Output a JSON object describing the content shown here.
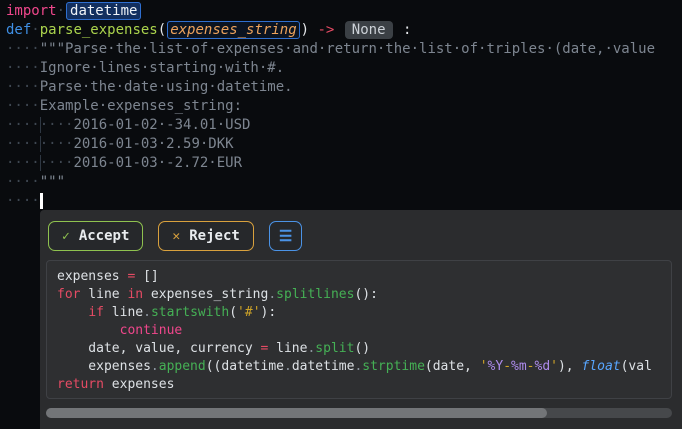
{
  "colors": {
    "editor_bg": "#090b0e",
    "popup_bg": "#2b2c2e",
    "accent_green": "#8fc24f",
    "accent_amber": "#d9a13d",
    "accent_blue": "#4b93e6",
    "highlight_box_blue": "#2f6fd0",
    "keyword_pink": "#f0478c",
    "keyword_red": "#e54b64",
    "function_lime": "#abd44d",
    "string_amber": "#cfa428",
    "method_green": "#45b055",
    "comment_gray": "#7d8590"
  },
  "editor": {
    "lines": [
      [
        [
          "kwp",
          "import"
        ],
        [
          "ws",
          "·"
        ],
        [
          "boxdt",
          "datetime"
        ]
      ],
      [
        [
          "def",
          "def"
        ],
        [
          "ws",
          "·"
        ],
        [
          "fn",
          "parse_expenses"
        ],
        [
          "txt",
          "("
        ],
        [
          "parambox",
          "expenses_string"
        ],
        [
          "txt",
          ")"
        ],
        [
          "sp",
          " "
        ],
        [
          "kwr",
          "->"
        ],
        [
          "sp",
          " "
        ],
        [
          "pill",
          "None"
        ],
        [
          "sp",
          " "
        ],
        [
          "txt",
          ":"
        ]
      ],
      [
        [
          "ws",
          "····"
        ],
        [
          "doc",
          "\"\"\"Parse·the·list·of·expenses·and·return·the·list·of·triples·(date,·value"
        ]
      ],
      [
        [
          "ws",
          "····"
        ],
        [
          "doc",
          "Ignore·lines·starting·with·#."
        ]
      ],
      [
        [
          "ws",
          "····"
        ],
        [
          "doc",
          "Parse·the·date·using·datetime."
        ]
      ],
      [
        [
          "ws",
          "····"
        ],
        [
          "doc",
          "Example·expenses_string:"
        ]
      ],
      [
        [
          "ws",
          "····"
        ],
        [
          "wsg",
          "····"
        ],
        [
          "doc",
          "2016-01-02·-34.01·USD"
        ]
      ],
      [
        [
          "ws",
          "····"
        ],
        [
          "wsg",
          "····"
        ],
        [
          "doc",
          "2016-01-03·2.59·DKK"
        ]
      ],
      [
        [
          "ws",
          "····"
        ],
        [
          "wsg",
          "····"
        ],
        [
          "doc",
          "2016-01-03·-2.72·EUR"
        ]
      ],
      [
        [
          "ws",
          "····"
        ],
        [
          "doc",
          "\"\"\""
        ]
      ],
      [
        [
          "ws",
          "····"
        ],
        [
          "cursor",
          ""
        ]
      ]
    ]
  },
  "popup": {
    "buttons": {
      "accept": {
        "icon": "✓",
        "label": "Accept"
      },
      "reject": {
        "icon": "✕",
        "label": "Reject"
      },
      "menu": {
        "icon": "☰"
      }
    },
    "code_lines": [
      [
        [
          "txt",
          "expenses "
        ],
        [
          "kwr",
          "="
        ],
        [
          "txt",
          " []"
        ]
      ],
      [
        [
          "kwr",
          "for"
        ],
        [
          "txt",
          " line "
        ],
        [
          "kwr",
          "in"
        ],
        [
          "txt",
          " expenses_string"
        ],
        [
          "dot",
          "."
        ],
        [
          "mth",
          "splitlines"
        ],
        [
          "txt",
          "():"
        ]
      ],
      [
        [
          "txt",
          "    "
        ],
        [
          "kwr",
          "if"
        ],
        [
          "txt",
          " line"
        ],
        [
          "dot",
          "."
        ],
        [
          "mth",
          "startswith"
        ],
        [
          "txt",
          "("
        ],
        [
          "str",
          "'#'"
        ],
        [
          "txt",
          "):"
        ]
      ],
      [
        [
          "txt",
          "        "
        ],
        [
          "kwp",
          "continue"
        ]
      ],
      [
        [
          "txt",
          "    date, value, currency "
        ],
        [
          "kwr",
          "="
        ],
        [
          "txt",
          " line"
        ],
        [
          "dot",
          "."
        ],
        [
          "mth",
          "split"
        ],
        [
          "txt",
          "()"
        ]
      ],
      [
        [
          "txt",
          "    expenses"
        ],
        [
          "dot",
          "."
        ],
        [
          "mth",
          "append"
        ],
        [
          "txt",
          "(("
        ],
        [
          "txt",
          "datetime"
        ],
        [
          "dot",
          "."
        ],
        [
          "txt",
          "datetime"
        ],
        [
          "dot",
          "."
        ],
        [
          "mth",
          "strptime"
        ],
        [
          "txt",
          "(date, "
        ],
        [
          "str",
          "'"
        ],
        [
          "fmt",
          "%Y"
        ],
        [
          "str",
          "-"
        ],
        [
          "fmt",
          "%m"
        ],
        [
          "str",
          "-"
        ],
        [
          "fmt",
          "%d"
        ],
        [
          "str",
          "'"
        ],
        [
          "txt",
          "), "
        ],
        [
          "flt",
          "float"
        ],
        [
          "txt",
          "(val"
        ]
      ],
      [
        [
          "kwr",
          "return"
        ],
        [
          "txt",
          " expenses"
        ]
      ]
    ]
  }
}
